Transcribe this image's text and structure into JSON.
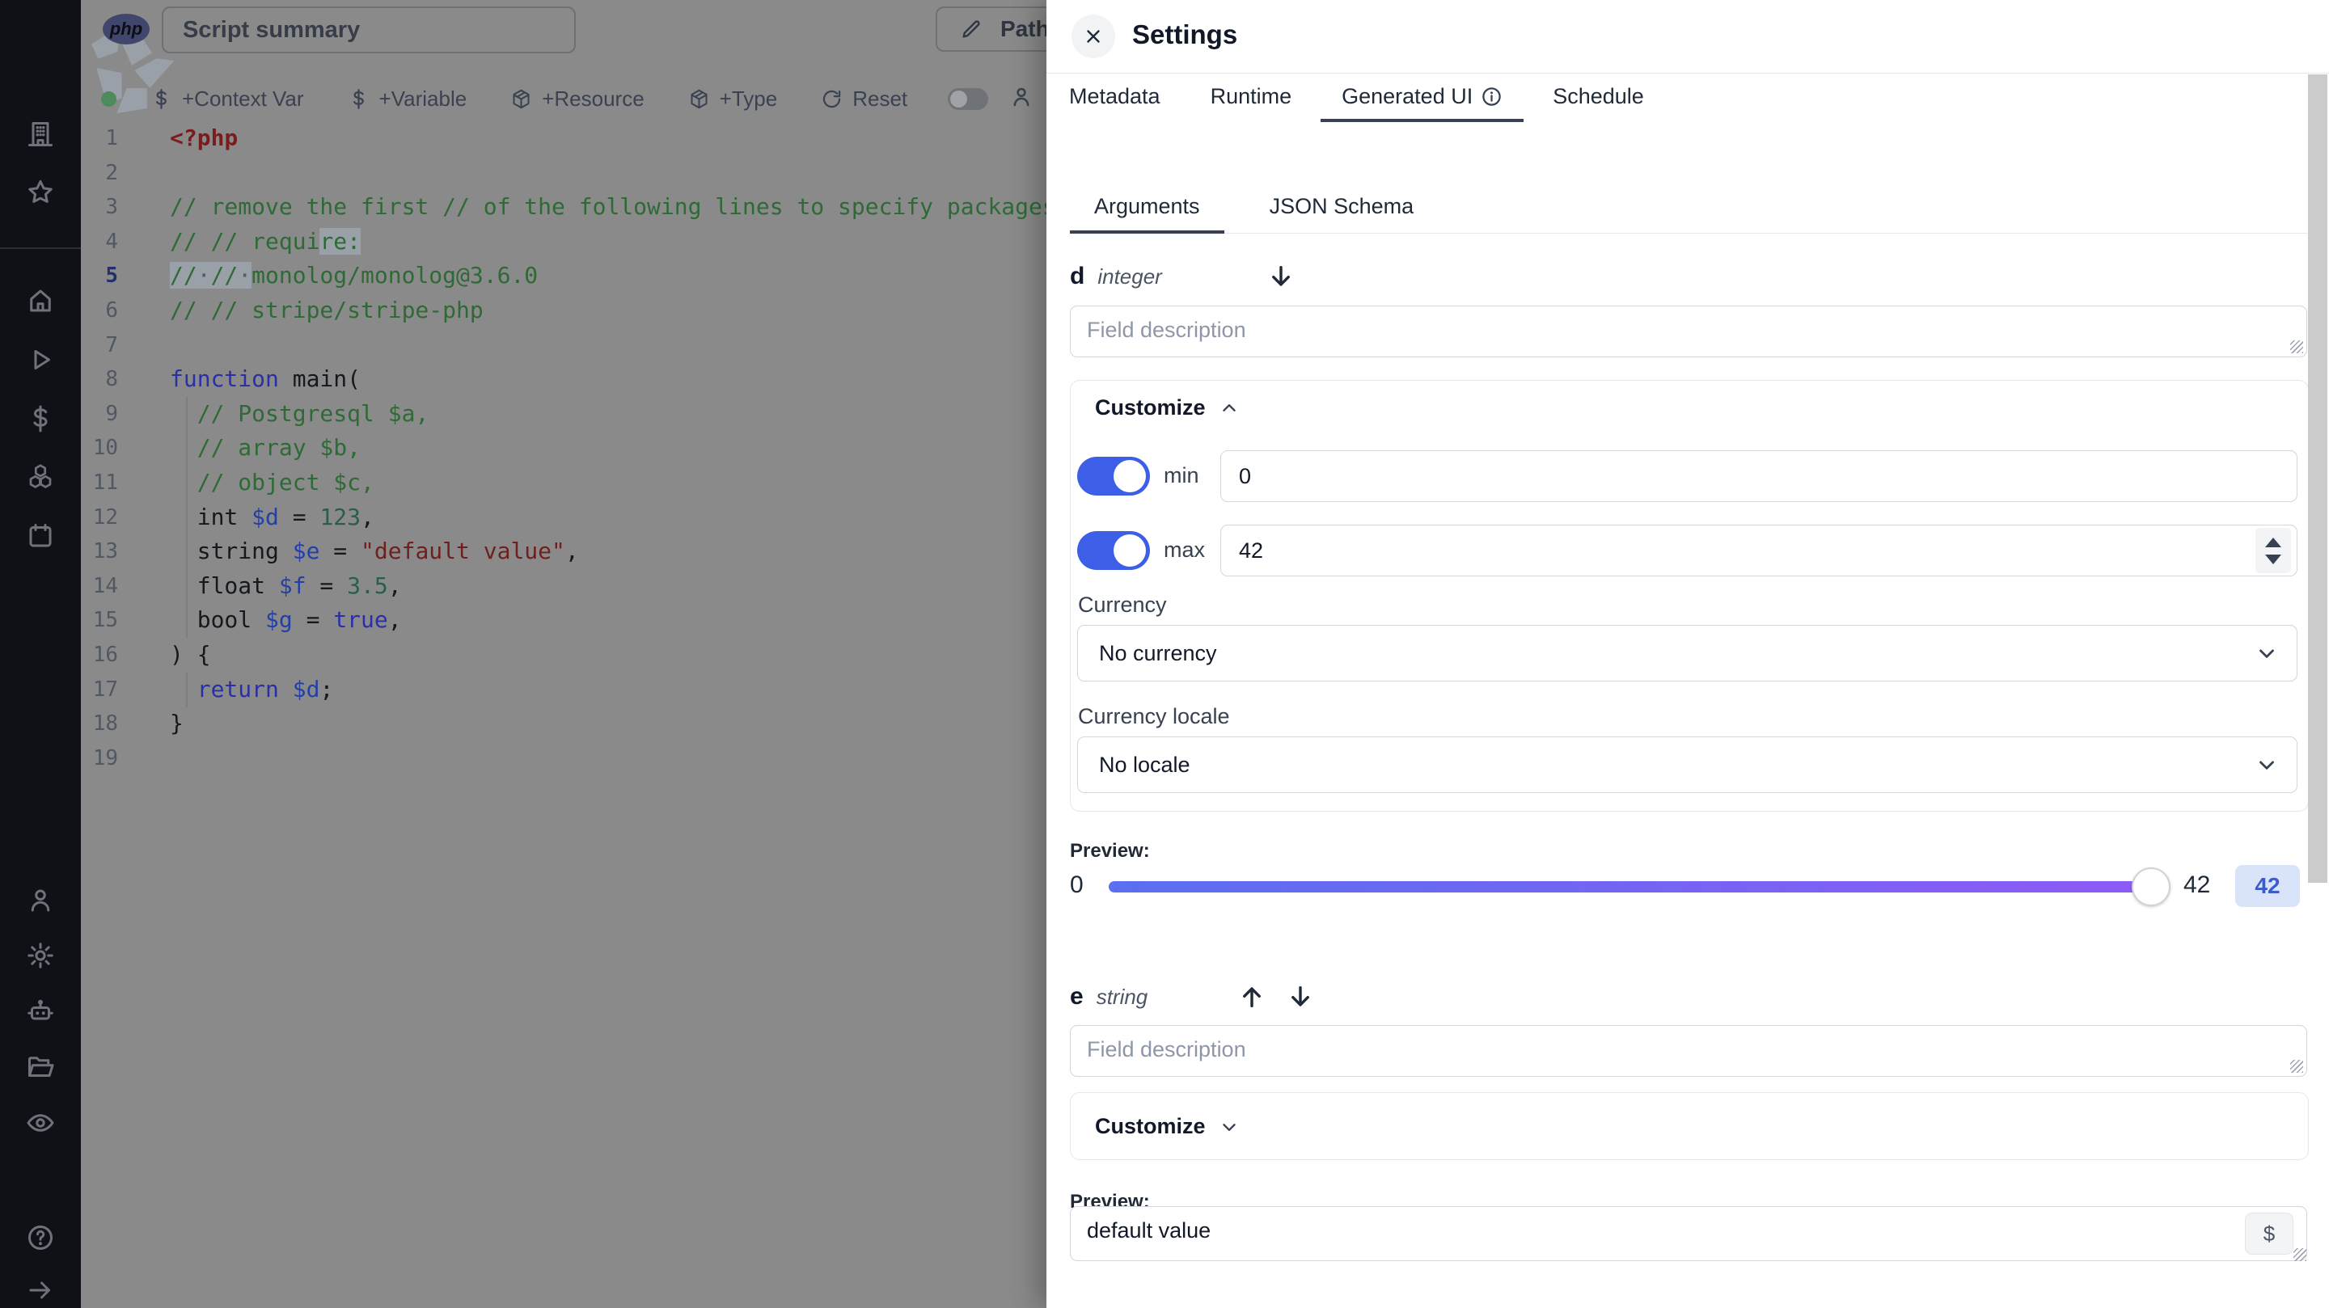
{
  "sidebar": {
    "logo_icon": "windmill-logo-icon",
    "items": [
      {
        "icon": "building-icon",
        "name": "workspace"
      },
      {
        "icon": "star-icon",
        "name": "favorites"
      },
      {
        "icon": "home-icon",
        "name": "home"
      },
      {
        "icon": "play-icon",
        "name": "runs"
      },
      {
        "icon": "dollar-icon",
        "name": "variables"
      },
      {
        "icon": "cubes-icon",
        "name": "resources"
      },
      {
        "icon": "calendar-icon",
        "name": "schedules"
      },
      {
        "icon": "user-icon",
        "name": "account"
      },
      {
        "icon": "gear-icon",
        "name": "settings"
      },
      {
        "icon": "robot-icon",
        "name": "workers"
      },
      {
        "icon": "folder-icon",
        "name": "folders"
      },
      {
        "icon": "eye-icon",
        "name": "audit-logs"
      },
      {
        "icon": "help-icon",
        "name": "help"
      },
      {
        "icon": "arrow-right-icon",
        "name": "expand-sidebar"
      }
    ]
  },
  "header": {
    "language_badge": "php",
    "summary_value": "Script summary",
    "path_button": "Path"
  },
  "toolbar": {
    "status_dot_color": "#4e8b5c",
    "items": [
      {
        "icon": "dollar-icon",
        "label": "+Context Var"
      },
      {
        "icon": "dollar-icon",
        "label": "+Variable"
      },
      {
        "icon": "package-icon",
        "label": "+Resource"
      },
      {
        "icon": "package-icon",
        "label": "+Type"
      },
      {
        "icon": "refresh-icon",
        "label": "Reset"
      }
    ]
  },
  "editor": {
    "lines": [
      {
        "n": "1",
        "t": [
          [
            "php",
            "<?php"
          ]
        ]
      },
      {
        "n": "2",
        "t": []
      },
      {
        "n": "3",
        "t": [
          [
            "cm",
            "// remove the first // of the following lines to specify packages"
          ]
        ]
      },
      {
        "n": "4",
        "t": [
          [
            "cm",
            "// // requi"
          ],
          [
            "cm sel",
            "re:"
          ]
        ]
      },
      {
        "n": "5",
        "a": true,
        "t": [
          [
            "cm sel",
            "//"
          ],
          [
            "ws sel",
            "·"
          ],
          [
            "cm sel",
            "//"
          ],
          [
            "ws sel",
            "·"
          ],
          [
            "cm",
            "monolog/monolog@3.6.0"
          ]
        ]
      },
      {
        "n": "6",
        "t": [
          [
            "cm",
            "// // stripe/stripe-php"
          ]
        ]
      },
      {
        "n": "7",
        "t": []
      },
      {
        "n": "8",
        "t": [
          [
            "kw",
            "function"
          ],
          [
            "pl",
            " main("
          ]
        ]
      },
      {
        "n": "9",
        "t": [
          [
            "pl",
            "  "
          ],
          [
            "cm",
            "// Postgresql $a,"
          ]
        ]
      },
      {
        "n": "10",
        "t": [
          [
            "pl",
            "  "
          ],
          [
            "cm",
            "// array $b,"
          ]
        ]
      },
      {
        "n": "11",
        "t": [
          [
            "pl",
            "  "
          ],
          [
            "cm",
            "// object $c,"
          ]
        ]
      },
      {
        "n": "12",
        "t": [
          [
            "pl",
            "  int "
          ],
          [
            "vr",
            "$d"
          ],
          [
            "pl",
            " = "
          ],
          [
            "nm",
            "123"
          ],
          [
            "pl",
            ","
          ]
        ]
      },
      {
        "n": "13",
        "t": [
          [
            "pl",
            "  string "
          ],
          [
            "vr",
            "$e"
          ],
          [
            "pl",
            " = "
          ],
          [
            "st",
            "\"default value\""
          ],
          [
            "pl",
            ","
          ]
        ]
      },
      {
        "n": "14",
        "t": [
          [
            "pl",
            "  float "
          ],
          [
            "vr",
            "$f"
          ],
          [
            "pl",
            " = "
          ],
          [
            "nm",
            "3.5"
          ],
          [
            "pl",
            ","
          ]
        ]
      },
      {
        "n": "15",
        "t": [
          [
            "pl",
            "  bool "
          ],
          [
            "vr",
            "$g"
          ],
          [
            "pl",
            " = "
          ],
          [
            "kw",
            "true"
          ],
          [
            "pl",
            ","
          ]
        ]
      },
      {
        "n": "16",
        "t": [
          [
            "pl",
            ") {"
          ]
        ]
      },
      {
        "n": "17",
        "t": [
          [
            "pl",
            "  "
          ],
          [
            "kw",
            "return"
          ],
          [
            "pl",
            " "
          ],
          [
            "vr",
            "$d"
          ],
          [
            "pl",
            ";"
          ]
        ]
      },
      {
        "n": "18",
        "t": [
          [
            "pl",
            "}"
          ]
        ]
      },
      {
        "n": "19",
        "t": []
      }
    ]
  },
  "panel": {
    "title": "Settings",
    "close_icon": "close-icon",
    "tabs": [
      {
        "label": "Metadata",
        "active": false,
        "info": false
      },
      {
        "label": "Runtime",
        "active": false,
        "info": false
      },
      {
        "label": "Generated UI",
        "active": true,
        "info": true
      },
      {
        "label": "Schedule",
        "active": false,
        "info": false
      }
    ],
    "subtabs": [
      {
        "label": "Arguments",
        "active": true
      },
      {
        "label": "JSON Schema",
        "active": false
      }
    ],
    "field_d": {
      "name": "d",
      "type": "integer",
      "description_placeholder": "Field description",
      "customize_label": "Customize",
      "min_label": "min",
      "min_value": "0",
      "max_label": "max",
      "max_value": "42",
      "currency_label": "Currency",
      "currency_value": "No currency",
      "locale_label": "Currency locale",
      "locale_value": "No locale",
      "preview_label": "Preview:",
      "slider_min": "0",
      "slider_value": "42",
      "badge_value": "42"
    },
    "field_e": {
      "name": "e",
      "type": "string",
      "description_placeholder": "Field description",
      "customize_label": "Customize",
      "preview_label": "Preview:",
      "preview_value": "default value",
      "dollar_button": "$"
    },
    "colors": {
      "toggle_on": "#3d5fe8",
      "slider_gradient_start": "#5b6ff0",
      "slider_gradient_end": "#8d5af5",
      "badge_bg": "#d9e4fb",
      "badge_text": "#3b5cc9",
      "active_tab_underline": "#374151"
    }
  }
}
